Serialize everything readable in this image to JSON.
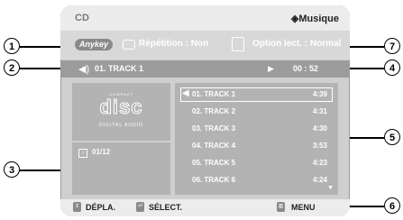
{
  "header": {
    "source": "CD",
    "mode_icon": "diamond-icon",
    "mode": "Musique"
  },
  "options": {
    "anykey": "Anykey",
    "repeat_icon": "repeat-icon",
    "repeat": "Répétition : Non",
    "program_icon": "play-option-icon",
    "play_option": "Option lect. : Normal"
  },
  "now_playing": {
    "speaker_icon": "speaker-icon",
    "track": "01. TRACK 1",
    "play_icon": "▶",
    "time": "00 : 52"
  },
  "disc_logo": {
    "top": "COMPACT",
    "main": "disc",
    "bottom": "DIGITAL AUDIO"
  },
  "counter": {
    "icon": "music-note-icon",
    "value": "01/12"
  },
  "tracks": [
    {
      "name": "01. TRACK 1",
      "duration": "4:39"
    },
    {
      "name": "02. TRACK 2",
      "duration": "4:31"
    },
    {
      "name": "03. TRACK 3",
      "duration": "4:30"
    },
    {
      "name": "04. TRACK 4",
      "duration": "3:53"
    },
    {
      "name": "05. TRACK 5",
      "duration": "4:23"
    },
    {
      "name": "06. TRACK 6",
      "duration": "4:24"
    }
  ],
  "bottom": {
    "move_label": "DÉPLA.",
    "select_label": "SÉLECT.",
    "menu_label": "MENU"
  },
  "callouts": [
    "1",
    "2",
    "3",
    "4",
    "5",
    "6",
    "7"
  ]
}
